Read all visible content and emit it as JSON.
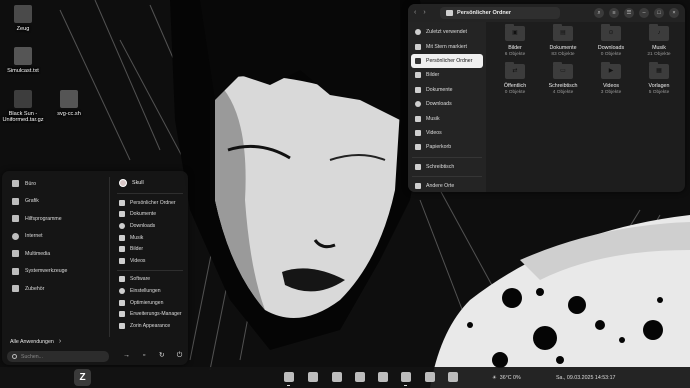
{
  "desktop": {
    "icons": [
      {
        "label": "Zeug"
      },
      {
        "label": "Simulcast.txt"
      },
      {
        "label": "Black Sun - Uniformed.tar.gz"
      },
      {
        "label": "svg-cc.sh"
      }
    ]
  },
  "start_menu": {
    "categories": [
      {
        "label": "Büro",
        "icon": "briefcase-icon"
      },
      {
        "label": "Grafik",
        "icon": "brush-icon"
      },
      {
        "label": "Hilfsprogramme",
        "icon": "tools-icon"
      },
      {
        "label": "Internet",
        "icon": "globe-icon"
      },
      {
        "label": "Multimedia",
        "icon": "film-icon"
      },
      {
        "label": "Systemwerkzeuge",
        "icon": "monitor-icon"
      },
      {
        "label": "Zubehör",
        "icon": "puzzle-icon"
      }
    ],
    "user": "Skull",
    "places": [
      {
        "label": "Persönlicher Ordner"
      },
      {
        "label": "Dokumente"
      },
      {
        "label": "Downloads"
      },
      {
        "label": "Musik"
      },
      {
        "label": "Bilder"
      },
      {
        "label": "Videos"
      }
    ],
    "system": [
      {
        "label": "Software"
      },
      {
        "label": "Einstellungen"
      },
      {
        "label": "Optimierungen"
      },
      {
        "label": "Erweiterungs-Manager"
      },
      {
        "label": "Zorin Appearance"
      }
    ],
    "all_apps": "Alle Anwendungen",
    "search_placeholder": "Suchen..."
  },
  "file_manager": {
    "title": "Persönlicher Ordner",
    "sidebar": [
      {
        "label": "Zuletzt verwendet",
        "active": false
      },
      {
        "label": "Mit Stern markiert",
        "active": false
      },
      {
        "label": "Persönlicher Ordner",
        "active": true
      },
      {
        "label": "Bilder",
        "active": false
      },
      {
        "label": "Dokumente",
        "active": false
      },
      {
        "label": "Downloads",
        "active": false
      },
      {
        "label": "Musik",
        "active": false
      },
      {
        "label": "Videos",
        "active": false
      },
      {
        "label": "Papierkorb",
        "active": false
      }
    ],
    "sidebar_extra": [
      {
        "label": "Schreibtisch"
      },
      {
        "label": "Andere Orte"
      }
    ],
    "folders": [
      {
        "name": "Bilder",
        "count": "6 Objekte",
        "icon": "image-icon"
      },
      {
        "name": "Dokumente",
        "count": "83 Objekte",
        "icon": "document-icon"
      },
      {
        "name": "Downloads",
        "count": "0 Objekte",
        "icon": "download-icon"
      },
      {
        "name": "Musik",
        "count": "21 Objekte",
        "icon": "music-icon"
      },
      {
        "name": "Öffentlich",
        "count": "0 Objekte",
        "icon": "share-icon"
      },
      {
        "name": "Schreibtisch",
        "count": "4 Objekte",
        "icon": "desktop-icon"
      },
      {
        "name": "Videos",
        "count": "3 Objekte",
        "icon": "video-icon"
      },
      {
        "name": "Vorlagen",
        "count": "5 Objekte",
        "icon": "template-icon"
      }
    ]
  },
  "taskbar": {
    "weather": "36°C 0%",
    "clock": "Sa., 09.03.2025  14:53:17"
  }
}
